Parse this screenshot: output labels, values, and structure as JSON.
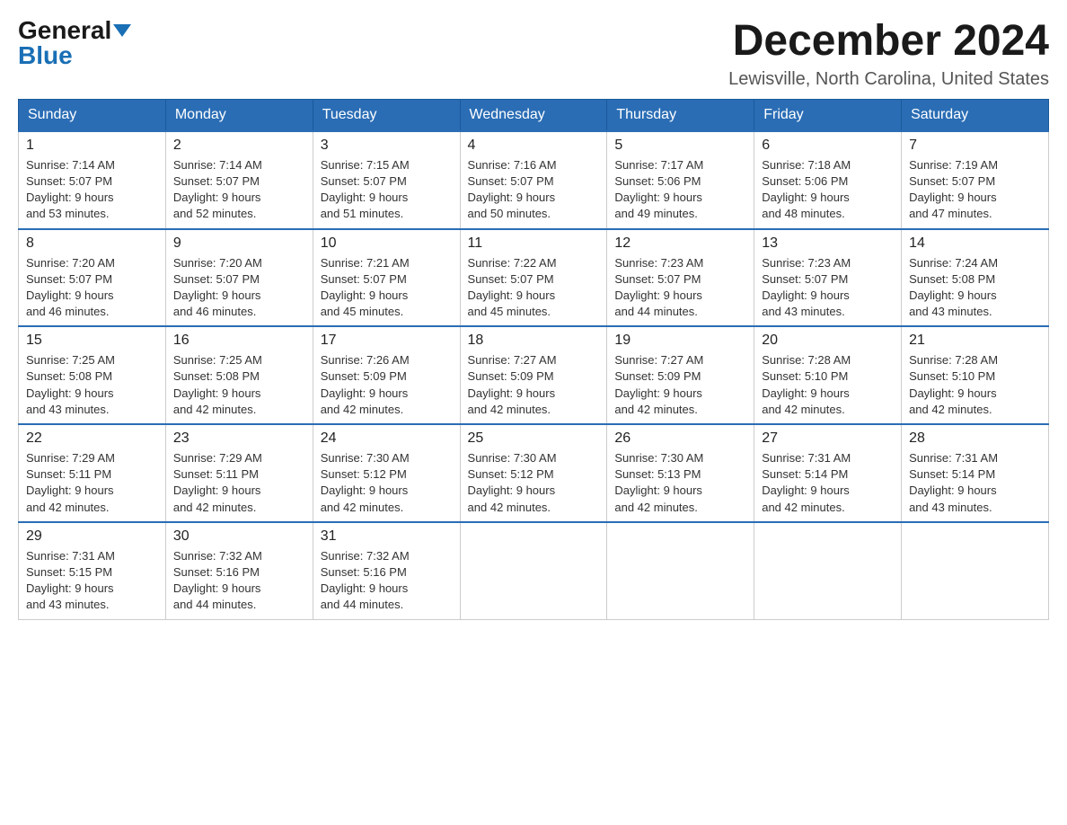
{
  "logo": {
    "general": "General",
    "blue": "Blue"
  },
  "header": {
    "month": "December 2024",
    "location": "Lewisville, North Carolina, United States"
  },
  "weekdays": [
    "Sunday",
    "Monday",
    "Tuesday",
    "Wednesday",
    "Thursday",
    "Friday",
    "Saturday"
  ],
  "weeks": [
    [
      {
        "day": "1",
        "info": "Sunrise: 7:14 AM\nSunset: 5:07 PM\nDaylight: 9 hours\nand 53 minutes."
      },
      {
        "day": "2",
        "info": "Sunrise: 7:14 AM\nSunset: 5:07 PM\nDaylight: 9 hours\nand 52 minutes."
      },
      {
        "day": "3",
        "info": "Sunrise: 7:15 AM\nSunset: 5:07 PM\nDaylight: 9 hours\nand 51 minutes."
      },
      {
        "day": "4",
        "info": "Sunrise: 7:16 AM\nSunset: 5:07 PM\nDaylight: 9 hours\nand 50 minutes."
      },
      {
        "day": "5",
        "info": "Sunrise: 7:17 AM\nSunset: 5:06 PM\nDaylight: 9 hours\nand 49 minutes."
      },
      {
        "day": "6",
        "info": "Sunrise: 7:18 AM\nSunset: 5:06 PM\nDaylight: 9 hours\nand 48 minutes."
      },
      {
        "day": "7",
        "info": "Sunrise: 7:19 AM\nSunset: 5:07 PM\nDaylight: 9 hours\nand 47 minutes."
      }
    ],
    [
      {
        "day": "8",
        "info": "Sunrise: 7:20 AM\nSunset: 5:07 PM\nDaylight: 9 hours\nand 46 minutes."
      },
      {
        "day": "9",
        "info": "Sunrise: 7:20 AM\nSunset: 5:07 PM\nDaylight: 9 hours\nand 46 minutes."
      },
      {
        "day": "10",
        "info": "Sunrise: 7:21 AM\nSunset: 5:07 PM\nDaylight: 9 hours\nand 45 minutes."
      },
      {
        "day": "11",
        "info": "Sunrise: 7:22 AM\nSunset: 5:07 PM\nDaylight: 9 hours\nand 45 minutes."
      },
      {
        "day": "12",
        "info": "Sunrise: 7:23 AM\nSunset: 5:07 PM\nDaylight: 9 hours\nand 44 minutes."
      },
      {
        "day": "13",
        "info": "Sunrise: 7:23 AM\nSunset: 5:07 PM\nDaylight: 9 hours\nand 43 minutes."
      },
      {
        "day": "14",
        "info": "Sunrise: 7:24 AM\nSunset: 5:08 PM\nDaylight: 9 hours\nand 43 minutes."
      }
    ],
    [
      {
        "day": "15",
        "info": "Sunrise: 7:25 AM\nSunset: 5:08 PM\nDaylight: 9 hours\nand 43 minutes."
      },
      {
        "day": "16",
        "info": "Sunrise: 7:25 AM\nSunset: 5:08 PM\nDaylight: 9 hours\nand 42 minutes."
      },
      {
        "day": "17",
        "info": "Sunrise: 7:26 AM\nSunset: 5:09 PM\nDaylight: 9 hours\nand 42 minutes."
      },
      {
        "day": "18",
        "info": "Sunrise: 7:27 AM\nSunset: 5:09 PM\nDaylight: 9 hours\nand 42 minutes."
      },
      {
        "day": "19",
        "info": "Sunrise: 7:27 AM\nSunset: 5:09 PM\nDaylight: 9 hours\nand 42 minutes."
      },
      {
        "day": "20",
        "info": "Sunrise: 7:28 AM\nSunset: 5:10 PM\nDaylight: 9 hours\nand 42 minutes."
      },
      {
        "day": "21",
        "info": "Sunrise: 7:28 AM\nSunset: 5:10 PM\nDaylight: 9 hours\nand 42 minutes."
      }
    ],
    [
      {
        "day": "22",
        "info": "Sunrise: 7:29 AM\nSunset: 5:11 PM\nDaylight: 9 hours\nand 42 minutes."
      },
      {
        "day": "23",
        "info": "Sunrise: 7:29 AM\nSunset: 5:11 PM\nDaylight: 9 hours\nand 42 minutes."
      },
      {
        "day": "24",
        "info": "Sunrise: 7:30 AM\nSunset: 5:12 PM\nDaylight: 9 hours\nand 42 minutes."
      },
      {
        "day": "25",
        "info": "Sunrise: 7:30 AM\nSunset: 5:12 PM\nDaylight: 9 hours\nand 42 minutes."
      },
      {
        "day": "26",
        "info": "Sunrise: 7:30 AM\nSunset: 5:13 PM\nDaylight: 9 hours\nand 42 minutes."
      },
      {
        "day": "27",
        "info": "Sunrise: 7:31 AM\nSunset: 5:14 PM\nDaylight: 9 hours\nand 42 minutes."
      },
      {
        "day": "28",
        "info": "Sunrise: 7:31 AM\nSunset: 5:14 PM\nDaylight: 9 hours\nand 43 minutes."
      }
    ],
    [
      {
        "day": "29",
        "info": "Sunrise: 7:31 AM\nSunset: 5:15 PM\nDaylight: 9 hours\nand 43 minutes."
      },
      {
        "day": "30",
        "info": "Sunrise: 7:32 AM\nSunset: 5:16 PM\nDaylight: 9 hours\nand 44 minutes."
      },
      {
        "day": "31",
        "info": "Sunrise: 7:32 AM\nSunset: 5:16 PM\nDaylight: 9 hours\nand 44 minutes."
      },
      {
        "day": "",
        "info": ""
      },
      {
        "day": "",
        "info": ""
      },
      {
        "day": "",
        "info": ""
      },
      {
        "day": "",
        "info": ""
      }
    ]
  ]
}
